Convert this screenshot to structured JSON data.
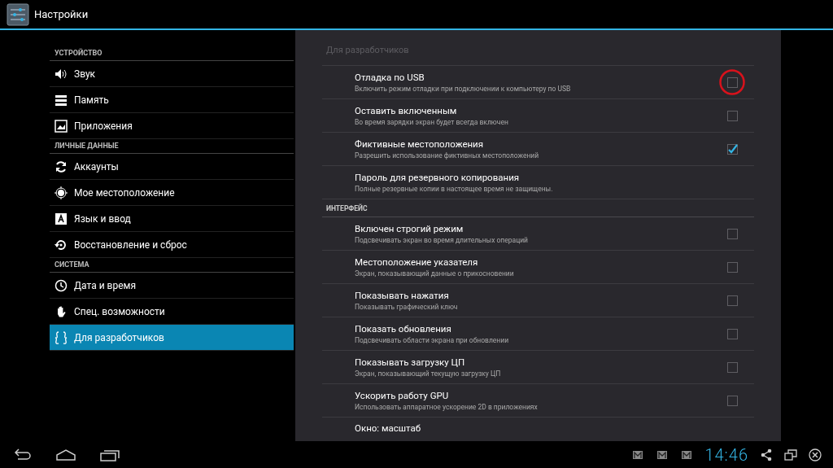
{
  "action_bar": {
    "title": "Настройки"
  },
  "sidebar": {
    "groups": [
      {
        "header": "УСТРОЙСТВО",
        "items": [
          {
            "label": "Звук",
            "selected": false
          },
          {
            "label": "Память",
            "selected": false
          },
          {
            "label": "Приложения",
            "selected": false
          }
        ]
      },
      {
        "header": "ЛИЧНЫЕ ДАННЫЕ",
        "items": [
          {
            "label": "Аккаунты",
            "selected": false
          },
          {
            "label": "Мое местоположение",
            "selected": false
          },
          {
            "label": "Язык и ввод",
            "selected": false
          },
          {
            "label": "Восстановление и сброс",
            "selected": false
          }
        ]
      },
      {
        "header": "СИСТЕМА",
        "items": [
          {
            "label": "Дата и время",
            "selected": false
          },
          {
            "label": "Спец. возможности",
            "selected": false
          },
          {
            "label": "Для разработчиков",
            "selected": true
          }
        ]
      }
    ]
  },
  "panel": {
    "title": "Для разработчиков",
    "sections": [
      {
        "items": [
          {
            "kind": "checkbox",
            "title": "Отладка по USB",
            "summary": "Включить режим отладки при подключении к компьютеру по USB",
            "checked": false,
            "highlighted": true
          },
          {
            "kind": "checkbox",
            "title": "Оставить включенным",
            "summary": "Во время зарядки экран будет всегда включен",
            "checked": false,
            "highlighted": false
          },
          {
            "kind": "checkbox",
            "title": "Фиктивные местоположения",
            "summary": "Разрешить использование фиктивных местоположений",
            "checked": true,
            "highlighted": false
          },
          {
            "kind": "plain",
            "title": "Пароль для резервного копирования",
            "summary": "Полные резервные копии в настоящее время не защищены."
          }
        ]
      },
      {
        "header": "ИНТЕРФЕЙС",
        "items": [
          {
            "kind": "checkbox",
            "title": "Включен строгий режим",
            "summary": "Подсвечивать экран во время длительных операций",
            "checked": false,
            "highlighted": false
          },
          {
            "kind": "checkbox",
            "title": "Местоположение указателя",
            "summary": "Экран, показывающий данные о прикосновении",
            "checked": false,
            "highlighted": false
          },
          {
            "kind": "checkbox",
            "title": "Показывать нажатия",
            "summary": "Показывать графический ключ",
            "checked": false,
            "highlighted": false
          },
          {
            "kind": "checkbox",
            "title": "Показать обновления",
            "summary": "Подсвечивать области экрана при обновлении",
            "checked": false,
            "highlighted": false
          },
          {
            "kind": "checkbox",
            "title": "Показывать загрузку ЦП",
            "summary": "Экран, показывающий текущую загрузку ЦП",
            "checked": false,
            "highlighted": false
          },
          {
            "kind": "checkbox",
            "title": "Ускорить работу GPU",
            "summary": "Использовать аппаратное ускорение 2D в приложениях",
            "checked": false,
            "highlighted": false
          },
          {
            "kind": "partial",
            "title": "Окно: масштаб"
          }
        ]
      }
    ]
  },
  "status_bar": {
    "time": "14:46"
  }
}
